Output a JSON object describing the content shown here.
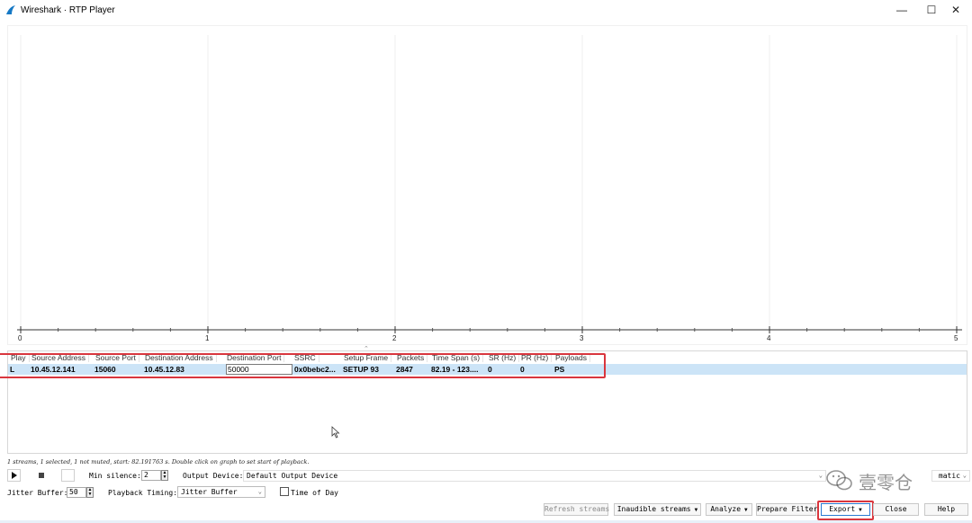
{
  "window": {
    "title": "Wireshark · RTP Player",
    "controls": {
      "minimize": "—",
      "maximize": "☐",
      "close": "✕"
    }
  },
  "graph": {
    "x_ticks": [
      "0",
      "1",
      "2",
      "3",
      "4",
      "5"
    ],
    "x_range": [
      0,
      5
    ]
  },
  "table": {
    "columns": [
      "Play",
      "Source Address",
      "Source Port",
      "Destination Address",
      "Destination Port",
      "SSRC",
      "Setup Frame",
      "Packets",
      "Time Span (s)",
      "SR (Hz)",
      "PR (Hz)",
      "Payloads"
    ],
    "rows": [
      {
        "play": "L",
        "source_address": "10.45.12.141",
        "source_port": "15060",
        "destination_address": "10.45.12.83",
        "destination_port": "50000",
        "ssrc": "0x0bebc2...",
        "setup_frame": "SETUP 93",
        "packets": "2847",
        "time_span": "82.19 - 123....",
        "sr": "0",
        "pr": "0",
        "payloads": "PS"
      }
    ]
  },
  "status": "1 streams, 1 selected, 1 not muted, start: 82.191763 s. Double click on graph to set start of playback.",
  "controls": {
    "play_icon": "play-icon",
    "stop_icon": "stop-icon",
    "min_silence_label": "Min silence:",
    "min_silence_value": "2",
    "output_device_label": "Output Device:",
    "output_device_value": "Default Output Device",
    "audio_routing_value": "matic",
    "jitter_buffer_label": "Jitter Buffer:",
    "jitter_buffer_value": "50",
    "playback_timing_label": "Playback Timing:",
    "playback_timing_value": "Jitter Buffer",
    "time_of_day_label": "Time of Day"
  },
  "buttons": {
    "refresh_streams": "Refresh streams",
    "inaudible_streams": "Inaudible streams",
    "analyze": "Analyze",
    "prepare_filter": "Prepare Filter",
    "export": "Export",
    "close": "Close",
    "help": "Help"
  },
  "watermark": {
    "text": "壹零仓",
    "icon": "wechat-icon"
  },
  "colors": {
    "selection": "#cce4f7",
    "annotation_red": "#d9363e"
  }
}
